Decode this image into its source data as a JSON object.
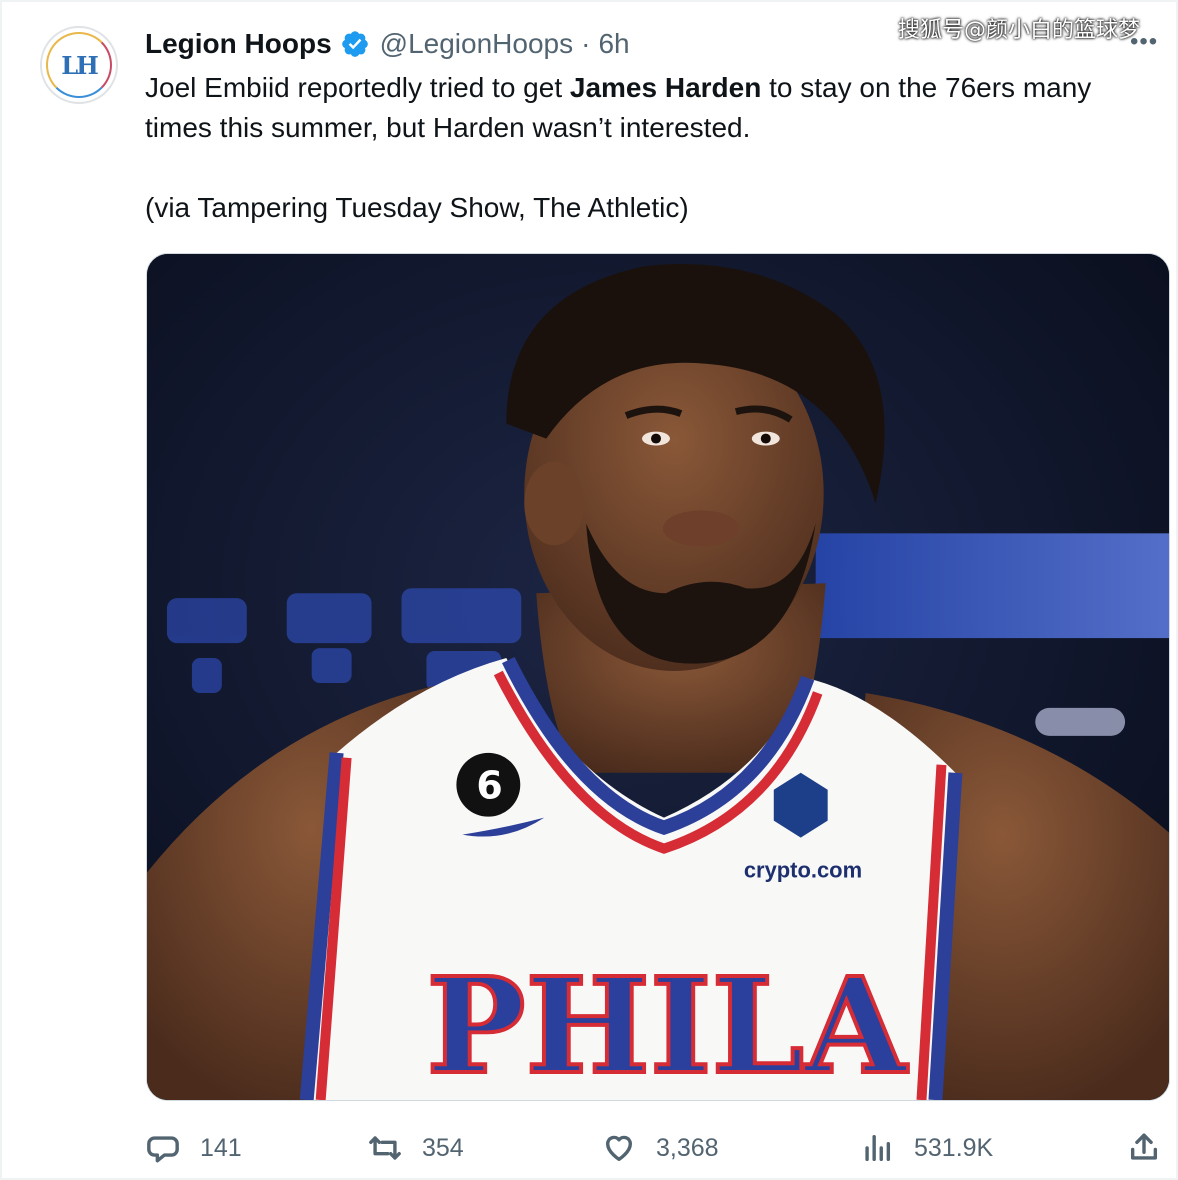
{
  "account": {
    "name": "Legion Hoops",
    "handle": "@LegionHoops",
    "separator": "·",
    "time": "6h",
    "avatar_icon": "legion-hoops-logo-icon",
    "verified_icon": "verified-badge-icon",
    "avatar_text": "LH"
  },
  "watermark": "搜狐号@颜小白的篮球梦",
  "more_label": "•••",
  "tweet": {
    "text_before": "Joel Embiid reportedly tried to get ",
    "bold": "James Harden",
    "text_after": " to stay on the 76ers many times this summer, but Harden wasn’t interested.",
    "source": "(via Tampering Tuesday Show, The Athletic)"
  },
  "media": {
    "jersey_text": "PHILA",
    "patch_number": "6",
    "sponsor": "crypto.com"
  },
  "actions": {
    "reply": {
      "icon": "reply-icon",
      "count": "141"
    },
    "retweet": {
      "icon": "retweet-icon",
      "count": "354"
    },
    "like": {
      "icon": "like-icon",
      "count": "3,368"
    },
    "views": {
      "icon": "views-icon",
      "count": "531.9K"
    },
    "share": {
      "icon": "share-icon"
    }
  },
  "colors": {
    "accent_blue": "#1d9bf0",
    "secondary_text": "#536471",
    "sixers_blue": "#1f3b93",
    "sixers_red": "#d62c35"
  }
}
